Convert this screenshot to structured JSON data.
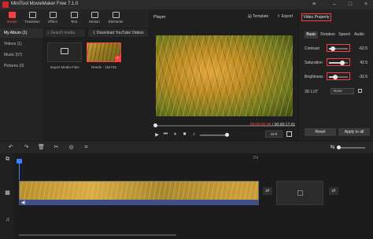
{
  "window": {
    "title": "MiniTool MovieMaker Free 7.1.0"
  },
  "toolbar": {
    "tabs": [
      {
        "label": "Media",
        "icon": "media-icon",
        "active": true
      },
      {
        "label": "Transition",
        "icon": "transition-icon"
      },
      {
        "label": "Effect",
        "icon": "effect-icon"
      },
      {
        "label": "Text",
        "icon": "text-icon"
      },
      {
        "label": "Motion",
        "icon": "motion-icon"
      },
      {
        "label": "Elements",
        "icon": "elements-icon"
      }
    ]
  },
  "library": {
    "categories": [
      "My Album (1)",
      "Videos (1)",
      "Music (57)",
      "Pictures (0)"
    ],
    "search_placeholder": "Search media",
    "download_label": "Download YouTube Videos",
    "import_label": "Import Media Files",
    "clip_label": "Reeds - 152746"
  },
  "player": {
    "label": "Player",
    "template_label": "Template",
    "export_label": "Export",
    "time_current": "00:00:00.00",
    "time_total": "/ 00:00:17.01",
    "aspect": "16:9"
  },
  "properties": {
    "title": "Video Property",
    "tabs": [
      "Basic",
      "Rotation",
      "Speed",
      "Audio"
    ],
    "rows": [
      {
        "label": "Contrast",
        "value": "-62.5",
        "level": 0.19
      },
      {
        "label": "Saturation",
        "value": "42.5",
        "level": 0.71
      },
      {
        "label": "Brightness",
        "value": "-32.5",
        "level": 0.34
      }
    ],
    "lut_label": "3D LUT",
    "lut_value": "None",
    "reset_label": "Reset",
    "apply_label": "Apply to all"
  },
  "timeline": {
    "ruler_label": "0's"
  },
  "colors": {
    "accent": "#ff3b44",
    "playhead": "#3d7fff",
    "audio": "#40518a"
  }
}
